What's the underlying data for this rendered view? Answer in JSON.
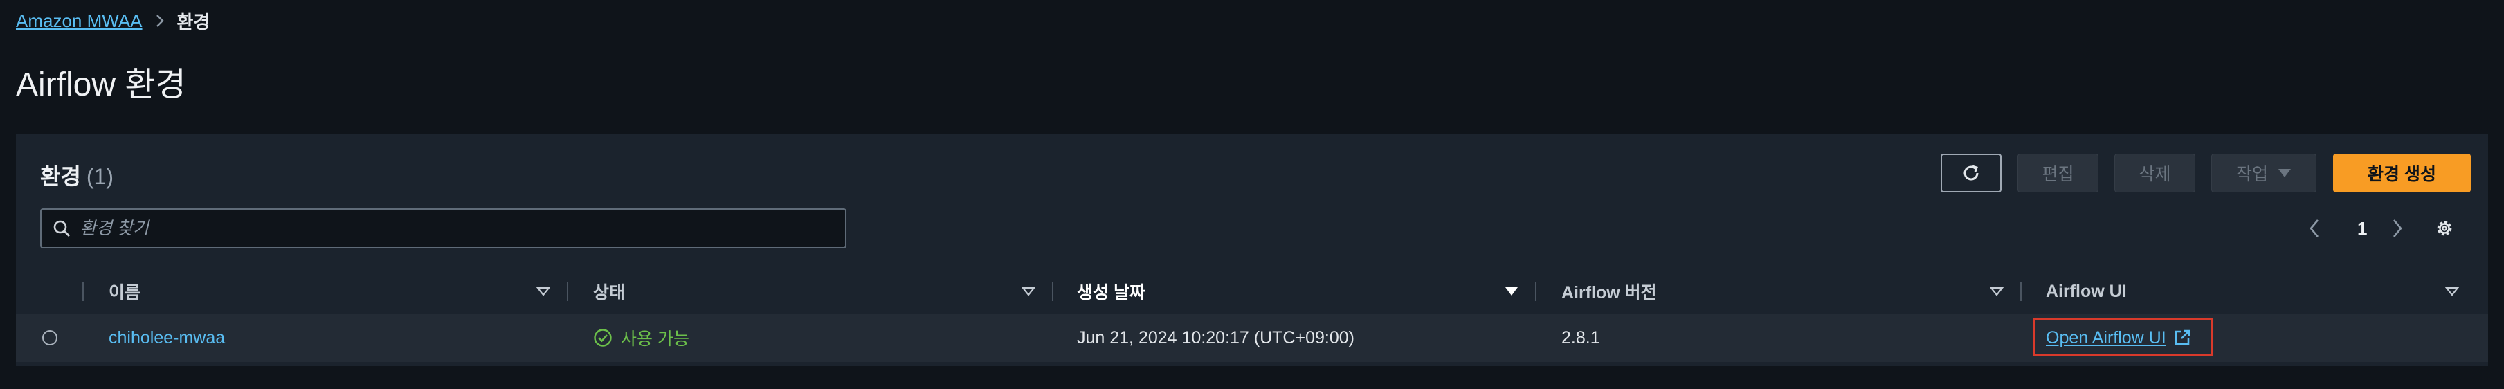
{
  "breadcrumb": {
    "root": "Amazon MWAA",
    "current": "환경"
  },
  "page": {
    "title": "Airflow 환경"
  },
  "panel": {
    "heading": "환경",
    "count": "(1)",
    "buttons": {
      "edit": "편집",
      "delete": "삭제",
      "actions": "작업",
      "create": "환경 생성"
    },
    "search": {
      "placeholder": "환경 찾기",
      "value": ""
    },
    "pagination": {
      "current_page": "1"
    }
  },
  "table": {
    "columns": [
      "이름",
      "상태",
      "생성 날짜",
      "Airflow 버전",
      "Airflow UI"
    ],
    "sorted_column": "생성 날짜",
    "rows": [
      {
        "name": "chiholee-mwaa",
        "status": "사용 가능",
        "created": "Jun 21, 2024 10:20:17 (UTC+09:00)",
        "version": "2.8.1",
        "ui_link": "Open Airflow UI"
      }
    ]
  },
  "colors": {
    "accent": "#f89c24",
    "link": "#59bdf2",
    "success": "#6cc04a",
    "highlight": "#d93a2b",
    "background": "#0f141a"
  },
  "icons": [
    "chevron-right-icon",
    "refresh-icon",
    "caret-down-icon",
    "search-icon",
    "chevron-left-icon",
    "gear-icon",
    "sort-icon",
    "check-circle-icon",
    "external-link-icon"
  ]
}
